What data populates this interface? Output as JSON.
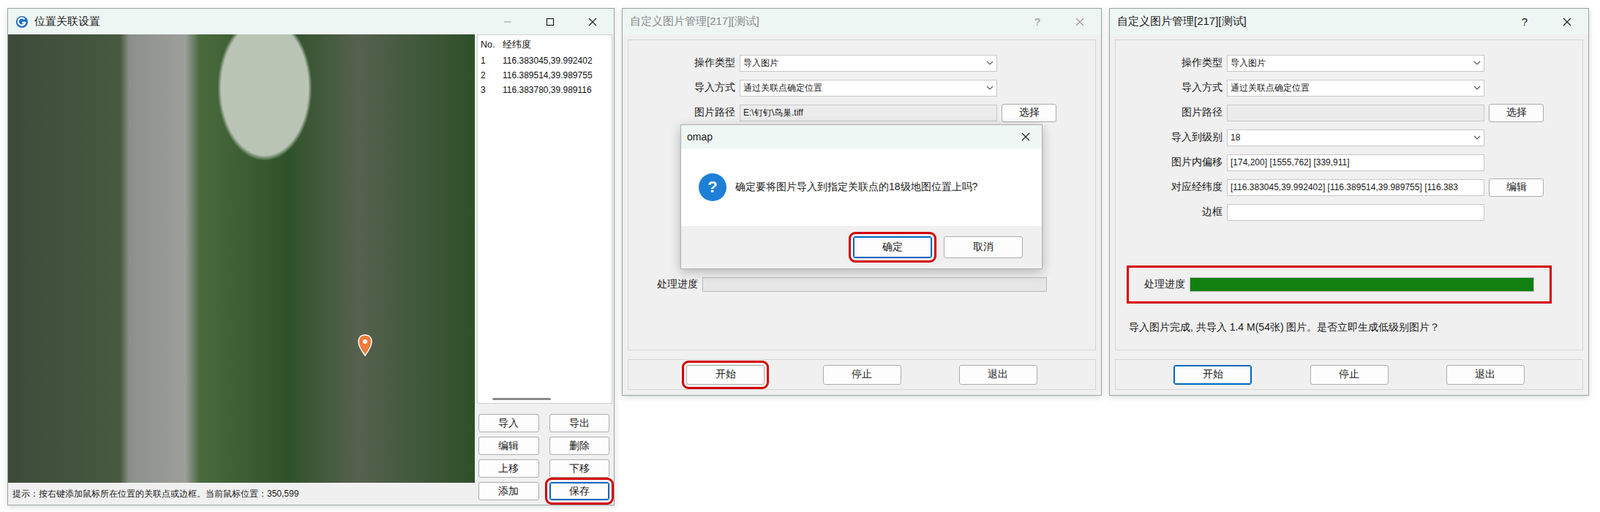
{
  "location_window": {
    "title": "位置关联设置",
    "list": {
      "columns": [
        "No.",
        "经纬度"
      ],
      "rows": [
        {
          "no": "1",
          "coord": "116.383045,39.992402",
          "selected": false
        },
        {
          "no": "2",
          "coord": "116.389514,39.989755",
          "selected": false
        },
        {
          "no": "3",
          "coord": "116.383780,39.989116",
          "selected": false
        }
      ]
    },
    "buttons": [
      {
        "label": "导入",
        "highlighted": false,
        "focused": false
      },
      {
        "label": "导出",
        "highlighted": false,
        "focused": false
      },
      {
        "label": "编辑",
        "highlighted": false,
        "focused": false
      },
      {
        "label": "删除",
        "highlighted": false,
        "focused": false
      },
      {
        "label": "上移",
        "highlighted": false,
        "focused": false
      },
      {
        "label": "下移",
        "highlighted": false,
        "focused": false
      },
      {
        "label": "添加",
        "highlighted": false,
        "focused": false
      },
      {
        "label": "保存",
        "highlighted": true,
        "focused": true
      }
    ],
    "status": "提示：按右键添加鼠标所在位置的关联点或边框。当前鼠标位置：350,599"
  },
  "import_windows": [
    {
      "title": "自定义图片管理[217][测试]",
      "active": false,
      "help": "?",
      "fields": [
        {
          "label": "操作类型",
          "kind": "select",
          "value": "导入图片",
          "disabled": false
        },
        {
          "label": "导入方式",
          "kind": "select",
          "value": "通过关联点确定位置",
          "disabled": false
        },
        {
          "label": "图片路径",
          "kind": "text",
          "value": "E:\\钉钉\\鸟巢.tiff",
          "disabled": true,
          "button": "选择"
        }
      ],
      "progress": {
        "label": "处理进度",
        "level": 0,
        "highlighted": false
      },
      "buttons": [
        {
          "label": "开始",
          "highlighted": true,
          "focused": false
        },
        {
          "label": "停止",
          "highlighted": false,
          "focused": false
        },
        {
          "label": "退出",
          "highlighted": false,
          "focused": false
        }
      ],
      "dialog": {
        "title": "omap",
        "icon": "?",
        "text": "确定要将图片导入到指定关联点的18级地图位置上吗?",
        "buttons": [
          {
            "label": "确定",
            "highlighted": true,
            "focused": true
          },
          {
            "label": "取消",
            "highlighted": false,
            "focused": false
          }
        ]
      }
    },
    {
      "title": "自定义图片管理[217][测试]",
      "active": true,
      "help": "?",
      "fields": [
        {
          "label": "操作类型",
          "kind": "select",
          "value": "导入图片",
          "disabled": false
        },
        {
          "label": "导入方式",
          "kind": "select",
          "value": "通过关联点确定位置",
          "disabled": false
        },
        {
          "label": "图片路径",
          "kind": "text",
          "value": "",
          "disabled": true,
          "button": "选择"
        },
        {
          "label": "导入到级别",
          "kind": "select",
          "value": "18",
          "disabled": false
        },
        {
          "label": "图片内偏移",
          "kind": "text",
          "value": "[174,200] [1555,762] [339,911]",
          "disabled": false
        },
        {
          "label": "对应经纬度",
          "kind": "text",
          "value": "[116.383045,39.992402] [116.389514,39.989755] [116.383",
          "disabled": false,
          "button": "编辑"
        },
        {
          "label": "边框",
          "kind": "text",
          "value": "",
          "disabled": false
        }
      ],
      "progress": {
        "label": "处理进度",
        "level": 1,
        "highlighted": true
      },
      "message": "导入图片完成, 共导入 1.4 M(54张) 图片。是否立即生成低级别图片？",
      "buttons": [
        {
          "label": "开始",
          "highlighted": false,
          "focused": true
        },
        {
          "label": "停止",
          "highlighted": false,
          "focused": false
        },
        {
          "label": "退出",
          "highlighted": false,
          "focused": false
        }
      ]
    }
  ]
}
